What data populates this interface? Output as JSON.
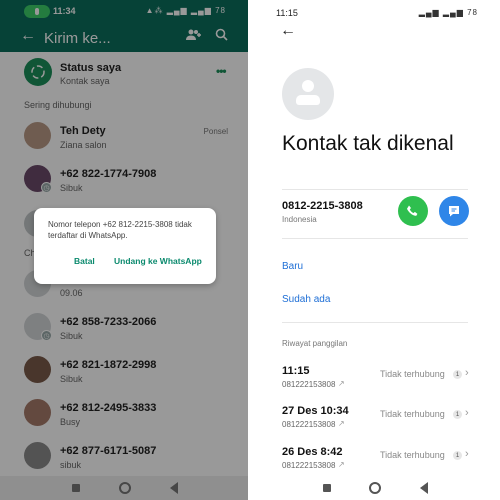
{
  "left": {
    "status_bar": {
      "time": "11:34",
      "icons": "▲⁂ ▂▄▆ ▂▄▆ 78"
    },
    "header": {
      "title": "Kirim ke...",
      "back_icon": "arrow-left-icon",
      "add_group_icon": "add-group-icon",
      "search_icon": "search-icon"
    },
    "my_status": {
      "name": "Status saya",
      "subtitle": "Kontak saya",
      "more": "•••"
    },
    "section_frequent": "Sering dihubungi",
    "section_chats": "Ch",
    "contacts": [
      {
        "name": "Teh Dety",
        "subtitle": "Ziana salon",
        "tag": "Ponsel",
        "avatar_color": "#b99a86"
      },
      {
        "name": "+62 822-1774-7908",
        "subtitle": "Sibuk",
        "tag": "",
        "avatar_color": "#6b4a6a"
      },
      {
        "name": "",
        "subtitle": "",
        "tag": "",
        "avatar_color": "#c2c7c9"
      },
      {
        "name": "",
        "subtitle": "09.06",
        "tag": "",
        "avatar_color": "#d3d6d8"
      },
      {
        "name": "+62 858-7233-2066",
        "subtitle": "Sibuk",
        "tag": "",
        "avatar_color": "#d3d6d8"
      },
      {
        "name": "+62 821-1872-2998",
        "subtitle": "Sibuk",
        "tag": "",
        "avatar_color": "#7a5a4a"
      },
      {
        "name": "+62 812-2495-3833",
        "subtitle": "Busy",
        "tag": "",
        "avatar_color": "#a67a6a"
      },
      {
        "name": "+62 877-6171-5087",
        "subtitle": "sibuk",
        "tag": "",
        "avatar_color": "#8a8a8a"
      }
    ],
    "dialog": {
      "message": "Nomor telepon +62 812-2215-3808 tidak terdaftar di WhatsApp.",
      "cancel": "Batal",
      "invite": "Undang ke WhatsApp"
    }
  },
  "right": {
    "status_bar": {
      "time": "11:15",
      "icons": "▂▄▆ ▂▄▆ 78"
    },
    "contact_name": "Kontak tak dikenal",
    "phone": "0812-2215-3808",
    "country": "Indonesia",
    "actions": {
      "new": "Baru",
      "existing": "Sudah ada"
    },
    "history_label": "Riwayat panggilan",
    "calls": [
      {
        "time": "11:15",
        "number": "081222153808",
        "status": "Tidak terhubung",
        "count": "1"
      },
      {
        "time": "27 Des 10:34",
        "number": "081222153808",
        "status": "Tidak terhubung",
        "count": "1"
      },
      {
        "time": "26 Des 8:42",
        "number": "081222153808",
        "status": "Tidak terhubung",
        "count": "1"
      }
    ],
    "colors": {
      "call": "#2fbf4f",
      "message": "#2f86e8",
      "link": "#1f6fd6"
    }
  },
  "colors": {
    "whatsapp_header": "#0b6e5c",
    "dialog_button": "#0b8a6e"
  }
}
